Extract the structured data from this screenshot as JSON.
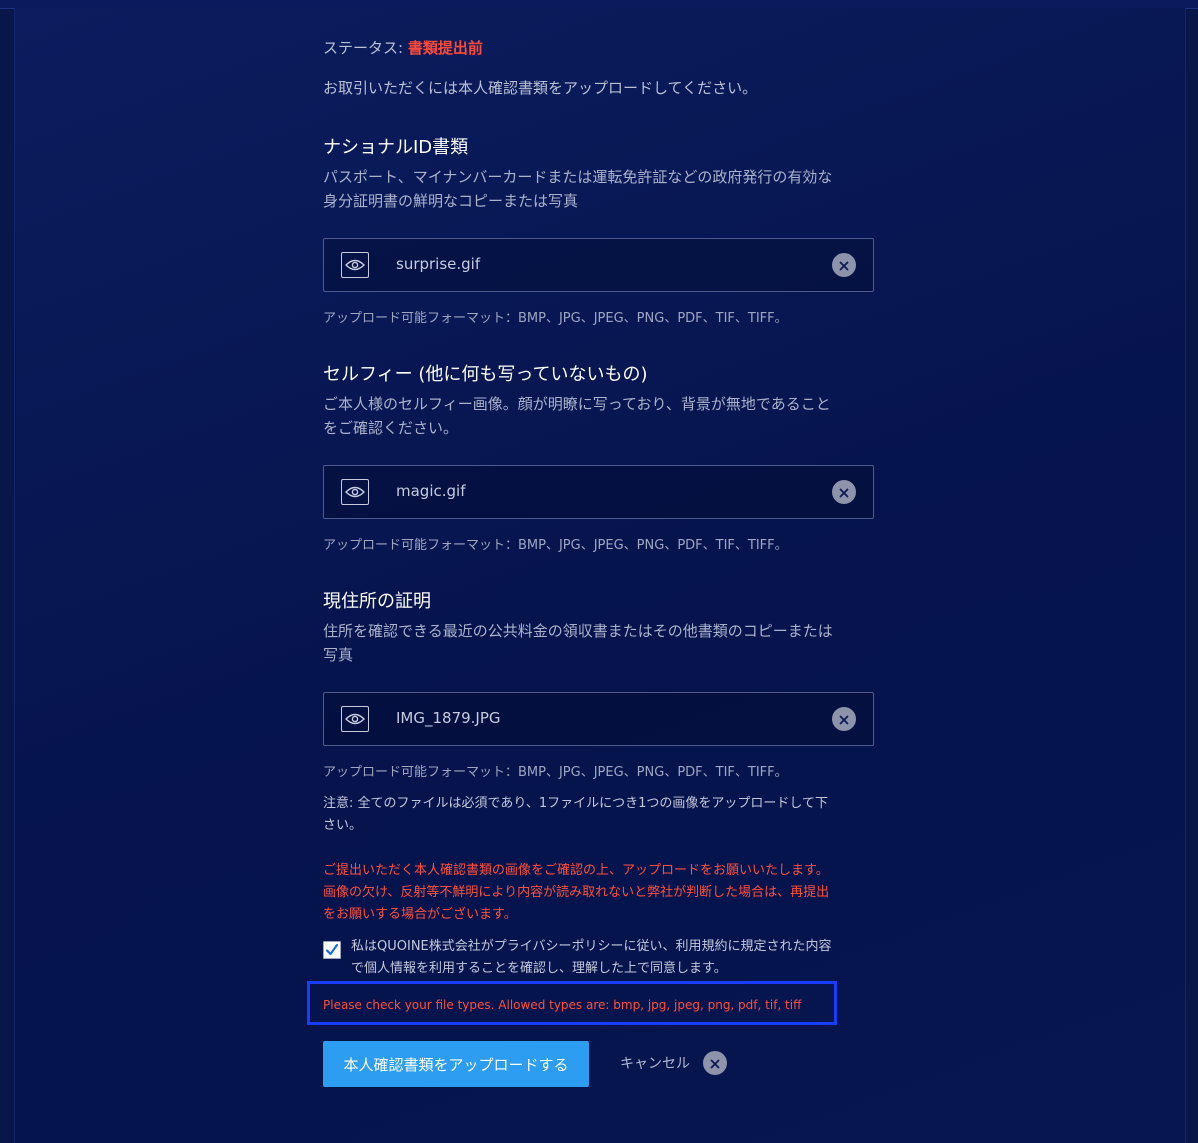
{
  "status": {
    "label": "ステータス:",
    "value": "書類提出前"
  },
  "intro": "お取引いただくには本人確認書類をアップロードしてください。",
  "sections": [
    {
      "title": "ナショナルID書類",
      "desc1": "パスポート、マイナンバーカードまたは運転免許証などの政府発行の有効な",
      "desc2": "身分証明書の鮮明なコピーまたは写真",
      "file_name": "surprise.gif",
      "formats": "アップロード可能フォーマット：BMP、JPG、JPEG、PNG、PDF、TIF、TIFF。"
    },
    {
      "title": "セルフィー (他に何も写っていないもの)",
      "desc1": "ご本人様のセルフィー画像。顔が明瞭に写っており、背景が無地であること",
      "desc2": "をご確認ください。",
      "file_name": "magic.gif",
      "formats": "アップロード可能フォーマット：BMP、JPG、JPEG、PNG、PDF、TIF、TIFF。"
    },
    {
      "title": "現住所の証明",
      "desc1": "住所を確認できる最近の公共料金の領収書またはその他書類のコピーまたは",
      "desc2": "写真",
      "file_name": "IMG_1879.JPG",
      "formats": "アップロード可能フォーマット：BMP、JPG、JPEG、PNG、PDF、TIF、TIFF。"
    }
  ],
  "note": {
    "line1": "注意: 全てのファイルは必須であり、1ファイルにつき1つの画像をアップロードして下",
    "line2": "さい。"
  },
  "warning": {
    "line1": "ご提出いただく本人確認書類の画像をご確認の上、アップロードをお願いいたします。",
    "line2": "画像の欠け、反射等不鮮明により内容が読み取れないと弊社が判断した場合は、再提出",
    "line3": "をお願いする場合がございます。"
  },
  "consent": {
    "checked": true,
    "line1": "私はQUOINE株式会社がプライバシーポリシーに従い、利用規約に規定された内容",
    "line2": "で個人情報を利用することを確認し、理解した上で同意します。"
  },
  "error_message": "Please check your file types. Allowed types are: bmp, jpg, jpeg, png, pdf, tif, tiff",
  "actions": {
    "submit_label": "本人確認書類をアップロードする",
    "cancel_label": "キャンセル"
  },
  "icons": {
    "preview": "eye-icon",
    "remove": "close-circle-icon",
    "checkbox": "checkmark-icon"
  },
  "colors": {
    "background": "#08164a",
    "status_value": "#ff4a3a",
    "warning_text": "#ff4f3c",
    "error_highlight_border": "#1a3cff",
    "submit_button": "#2c9df0"
  }
}
